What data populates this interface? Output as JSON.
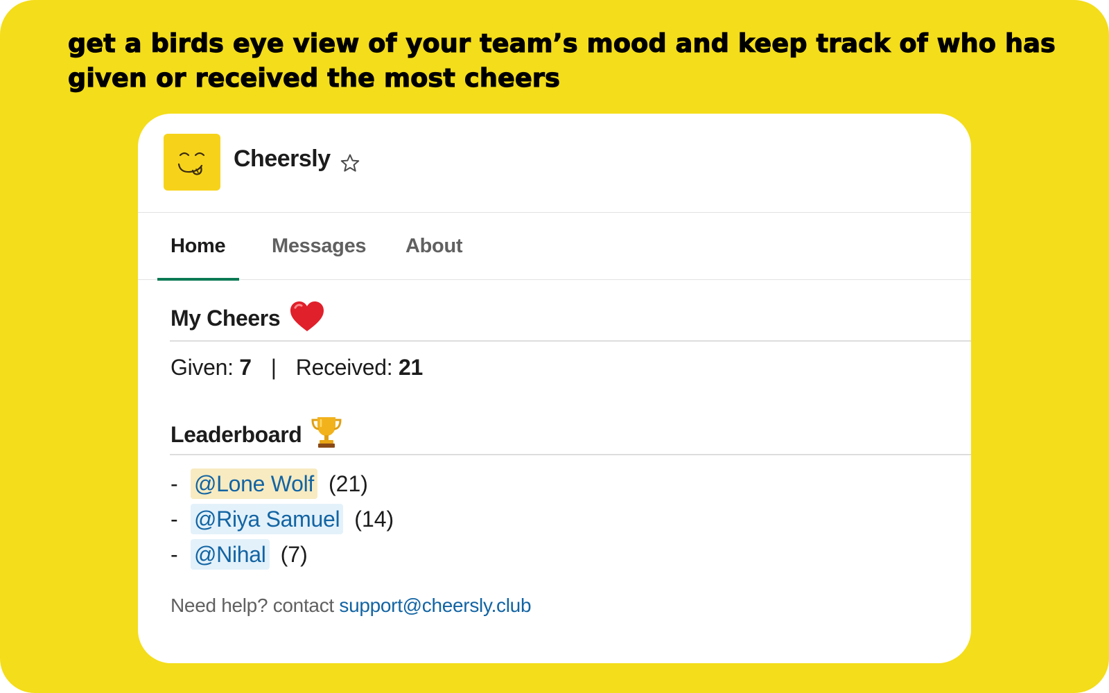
{
  "headline": "get a birds eye view of your team’s mood and keep track of who has given or received  the most cheers",
  "app": {
    "name": "Cheersly",
    "logo_icon": "smiley-face-icon",
    "brand_color": "#f6d31a"
  },
  "tabs": [
    {
      "label": "Home",
      "active": true
    },
    {
      "label": "Messages",
      "active": false
    },
    {
      "label": "About",
      "active": false
    }
  ],
  "my_cheers": {
    "title": "My Cheers",
    "title_icon": "heart-icon",
    "given_label": "Given:",
    "given_value": "7",
    "separator": "|",
    "received_label": "Received:",
    "received_value": "21"
  },
  "leaderboard": {
    "title": "Leaderboard",
    "title_icon": "trophy-icon",
    "entries": [
      {
        "bullet": "-",
        "user": "@Lone Wolf",
        "count": "(21)",
        "is_self": true
      },
      {
        "bullet": "-",
        "user": "@Riya Samuel",
        "count": "(14)",
        "is_self": false
      },
      {
        "bullet": "-",
        "user": "@Nihal",
        "count": "(7)",
        "is_self": false
      }
    ]
  },
  "help": {
    "text": "Need help? contact",
    "email": "support@cheersly.club"
  },
  "colors": {
    "background": "#f4dd1a",
    "active_tab": "#0b7a55",
    "link": "#1264a3"
  }
}
